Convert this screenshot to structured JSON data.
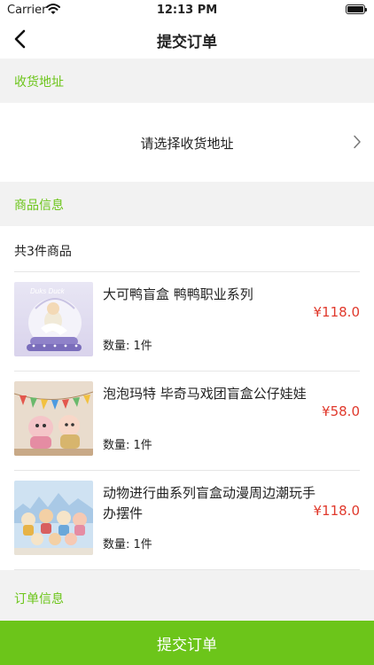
{
  "status_bar": {
    "carrier": "Carrier",
    "time": "12:13 PM",
    "battery_level": 1.0
  },
  "nav": {
    "title": "提交订单",
    "back_icon": "chevron-left-icon"
  },
  "address_section": {
    "title": "收货地址",
    "placeholder": "请选择收货地址",
    "chevron_icon": "chevron-right-icon"
  },
  "goods_section": {
    "title": "商品信息",
    "count_text": "共3件商品",
    "items": [
      {
        "name": "大可鸭盲盒 鸭鸭职业系列",
        "qty": "数量: 1件",
        "price": "¥118.0",
        "thumb_text": "Duks Duck"
      },
      {
        "name": "泡泡玛特 毕奇马戏团盲盒公仔娃娃",
        "qty": "数量: 1件",
        "price": "¥58.0"
      },
      {
        "name": "动物进行曲系列盲盒动漫周边潮玩手办摆件",
        "qty": "数量: 1件",
        "price": "¥118.0"
      }
    ]
  },
  "order_section": {
    "title": "订单信息"
  },
  "submit": {
    "label": "提交订单"
  },
  "colors": {
    "accent": "#6cc51a",
    "price": "#e0392c",
    "background": "#f2f2f2"
  }
}
